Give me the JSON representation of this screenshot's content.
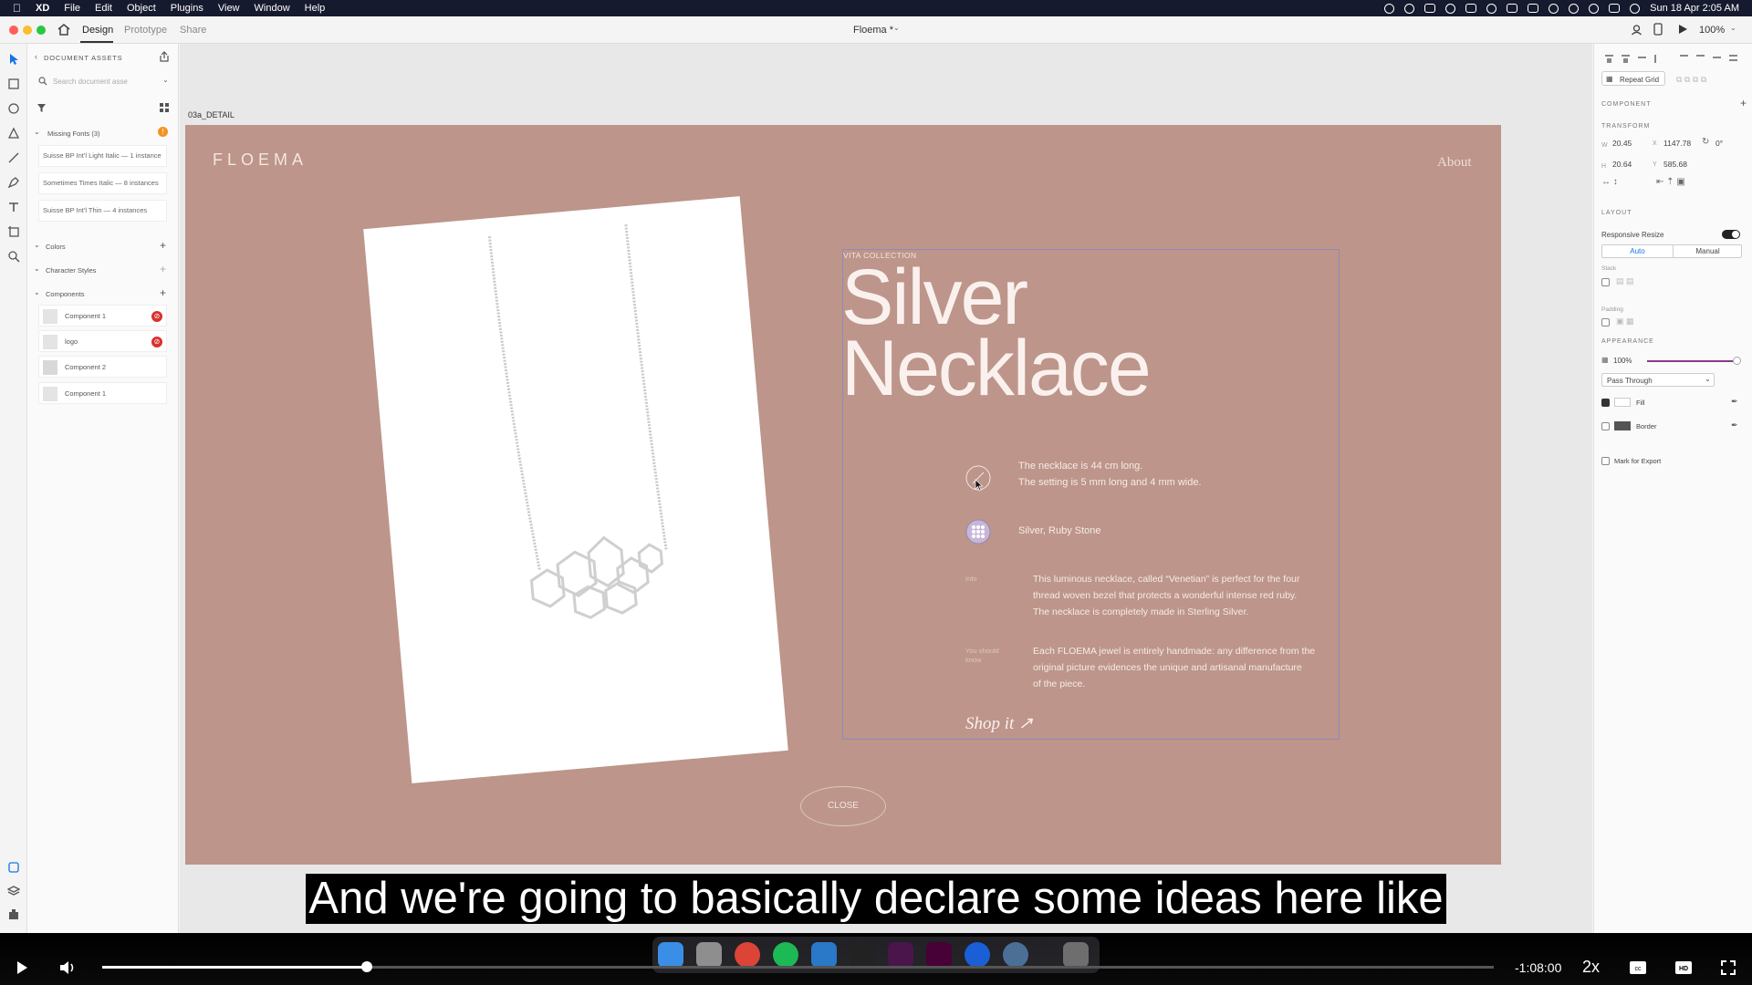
{
  "menubar": {
    "app_name": "XD",
    "items": [
      "File",
      "Edit",
      "Object",
      "Plugins",
      "View",
      "Window",
      "Help"
    ],
    "clock": "Sun 18 Apr  2:05 AM"
  },
  "titlebar": {
    "tabs": [
      "Design",
      "Prototype",
      "Share"
    ],
    "active_tab": "Design",
    "document_title": "Floema *",
    "zoom": "100%"
  },
  "assets_panel": {
    "header": "DOCUMENT ASSETS",
    "search_placeholder": "Search document asse",
    "missing_fonts_label": "Missing Fonts (3)",
    "missing_fonts": [
      "Suisse BP Int'l Light Italic — 1 instance",
      "Sometimes Times Italic — 8 instances",
      "Suisse BP Int'l Thin — 4 instances"
    ],
    "colors_label": "Colors",
    "character_styles_label": "Character Styles",
    "components_label": "Components",
    "components": [
      "Component 1",
      "logo",
      "Component 2",
      "Component 1"
    ]
  },
  "canvas": {
    "artboard_label": "03a_DETAIL",
    "logo_text": "FLOEMA",
    "about_link": "About",
    "collection_label": "VITA COLLECTION",
    "title_line1": "Silver",
    "title_line2": "Necklace",
    "spec_line1": "The necklace is 44 cm long.",
    "spec_line2": "The setting is 5 mm long and 4 mm wide.",
    "materials": "Silver, Ruby Stone",
    "info_label": "Info",
    "info_line1": "This luminous necklace, called “Venetian” is perfect for the four",
    "info_line2": "thread woven bezel that protects a wonderful intense red ruby.",
    "info_line3": "The necklace is completely made in Sterling Silver.",
    "know_label_1": "You should",
    "know_label_2": "know",
    "know_line1": "Each FLOEMA jewel is entirely handmade: any difference from the",
    "know_line2": "original picture evidences the unique and artisanal manufacture",
    "know_line3": "of the piece.",
    "shop_link": "Shop it ↗",
    "close_button": "CLOSE",
    "artboard_color": "#bd958a"
  },
  "inspector": {
    "repeat_grid": "Repeat Grid",
    "component_label": "COMPONENT",
    "transform_label": "TRANSFORM",
    "w_label": "W",
    "w_value": "20.45",
    "x_label": "X",
    "x_value": "1147.78",
    "rotation": "0°",
    "h_label": "H",
    "h_value": "20.64",
    "y_label": "Y",
    "y_value": "585.68",
    "layout_label": "LAYOUT",
    "responsive_resize": "Responsive Resize",
    "auto": "Auto",
    "manual": "Manual",
    "stack": "Stack",
    "padding": "Padding",
    "appearance_label": "APPEARANCE",
    "opacity": "100%",
    "blend_mode": "Pass Through",
    "fill": "Fill",
    "border": "Border",
    "mark_for_export": "Mark for Export"
  },
  "video": {
    "subtitle": "And we're going to basically declare some ideas here like",
    "time_remaining": "-1:08:00",
    "speed": "2x",
    "progress": 0.19
  }
}
